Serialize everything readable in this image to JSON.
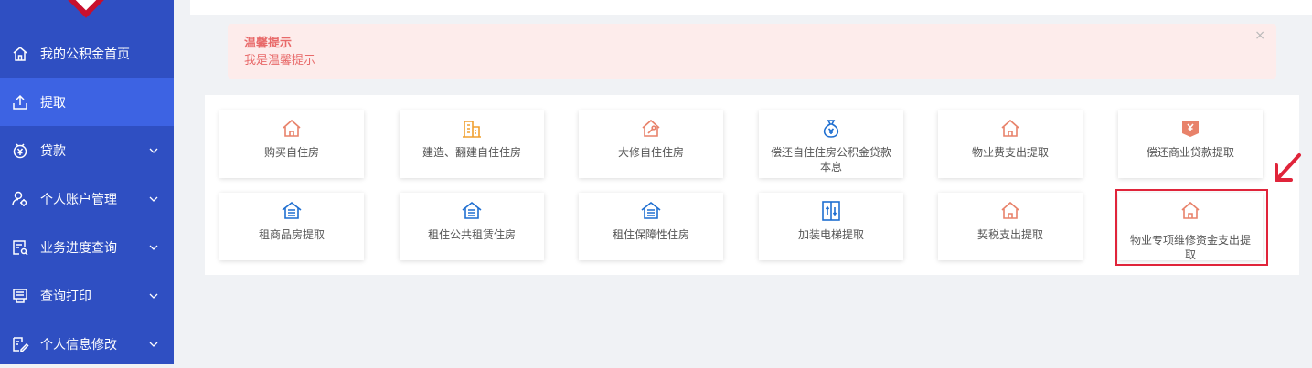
{
  "sidebar": {
    "items": [
      {
        "label": "我的公积金首页",
        "icon": "home-icon",
        "has_submenu": false,
        "active": false
      },
      {
        "label": "提取",
        "icon": "upload-icon",
        "has_submenu": false,
        "active": true
      },
      {
        "label": "贷款",
        "icon": "yuan-coin-icon",
        "has_submenu": true,
        "active": false
      },
      {
        "label": "个人账户管理",
        "icon": "user-gear-icon",
        "has_submenu": true,
        "active": false
      },
      {
        "label": "业务进度查询",
        "icon": "document-search-icon",
        "has_submenu": true,
        "active": false
      },
      {
        "label": "查询打印",
        "icon": "print-document-icon",
        "has_submenu": true,
        "active": false
      },
      {
        "label": "个人信息修改",
        "icon": "edit-profile-icon",
        "has_submenu": true,
        "active": false
      }
    ]
  },
  "notice": {
    "title": "温馨提示",
    "body": "我是温馨提示",
    "close": "×"
  },
  "cards": [
    {
      "label": "购买自住房",
      "icon": "house-icon"
    },
    {
      "label": "建造、翻建自住住房",
      "icon": "building-icon"
    },
    {
      "label": "大修自住住房",
      "icon": "house-repair-icon"
    },
    {
      "label": "偿还自住住房公积金贷款本息",
      "icon": "money-bag-icon"
    },
    {
      "label": "物业费支出提取",
      "icon": "house-icon"
    },
    {
      "label": "偿还商业贷款提取",
      "icon": "yuan-bill-icon"
    },
    {
      "label": "租商品房提取",
      "icon": "rental-house-icon"
    },
    {
      "label": "租住公共租赁住房",
      "icon": "rental-house-icon"
    },
    {
      "label": "租住保障性住房",
      "icon": "rental-house-icon"
    },
    {
      "label": "加装电梯提取",
      "icon": "elevator-icon"
    },
    {
      "label": "契税支出提取",
      "icon": "house-icon"
    },
    {
      "label": "物业专项维修资金支出提取",
      "icon": "house-icon"
    }
  ],
  "colors": {
    "sidebar_bg": "#2f4fc2",
    "sidebar_active": "#3d63e3",
    "notice_bg": "#fdeceb",
    "notice_text": "#e86a6a",
    "icon_orange": "#e8826a",
    "icon_blue": "#1f6fd1",
    "icon_amber": "#f0a030",
    "highlight": "#e0243a"
  }
}
